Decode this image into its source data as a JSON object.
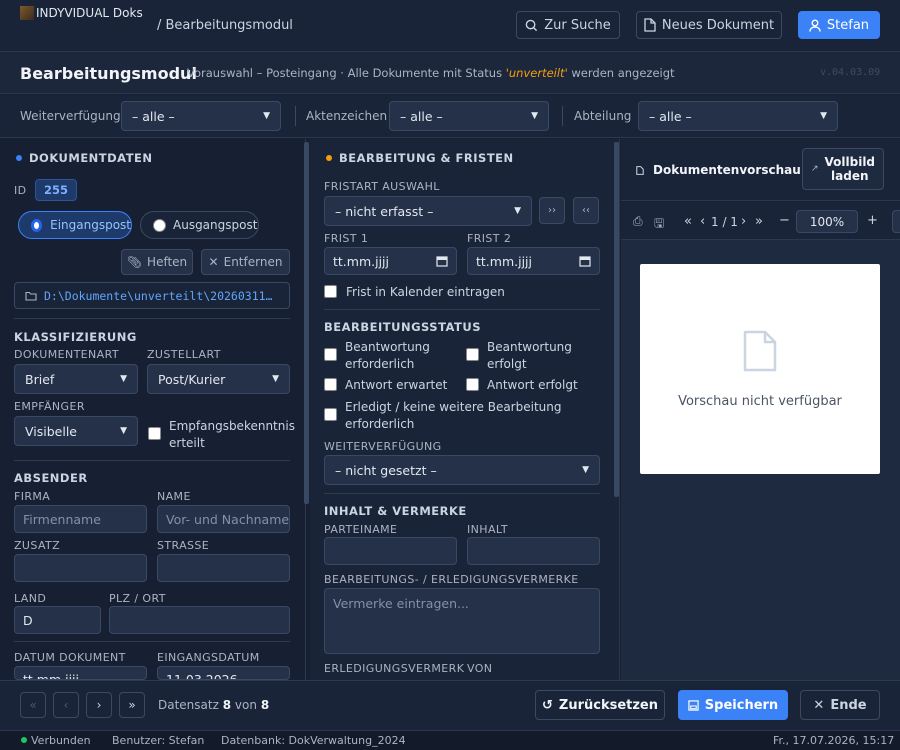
{
  "app": {
    "logo_text": "INDYVIDUAL Doks",
    "breadcrumb": "/ Bearbeitungsmodul",
    "search_label": "Zur Suche",
    "new_doc_label": "Neues Dokument",
    "user_label": "Stefan"
  },
  "module": {
    "title": "Bearbeitungsmodul",
    "subtitle_pre": "Vorauswahl – Posteingang · Alle Dokumente mit Status ",
    "subtitle_status": "'unverteilt'",
    "subtitle_post": " werden angezeigt",
    "version": "v.04.03.09"
  },
  "filters": {
    "weiterverfuegung_label": "Weiterverfügung",
    "weiterverfuegung_value": "– alle –",
    "aktenzeichen_label": "Aktenzeichen",
    "aktenzeichen_value": "– alle –",
    "abteilung_label": "Abteilung",
    "abteilung_value": "– alle –"
  },
  "left": {
    "head": "DOKUMENTDATEN",
    "id_label": "ID",
    "id_value": "255",
    "radio_in": "Eingangspost",
    "radio_out": "Ausgangspost",
    "heften": "Heften",
    "entfernen": "Entfernen",
    "path": "D:\\Dokumente\\unverteilt\\20260311…",
    "klass_head": "KLASSIFIZIERUNG",
    "dokart_label": "DOKUMENTENART",
    "dokart_value": "Brief",
    "zustell_label": "ZUSTELLART",
    "zustell_value": "Post/Kurier",
    "empf_label": "EMPFÄNGER",
    "empf_value": "Visibelle",
    "empfbek_label": "Empfangsbekenntnis erteilt",
    "abs_head": "ABSENDER",
    "firma_label": "FIRMA",
    "firma_ph": "Firmenname",
    "name_label": "NAME",
    "name_ph": "Vor- und Nachname",
    "zusatz_label": "ZUSATZ",
    "strasse_label": "STRASSE",
    "land_label": "LAND",
    "land_value": "D",
    "plz_label": "PLZ / ORT",
    "datum_dok_label": "DATUM DOKUMENT",
    "datum_dok_value": "tt.mm.jjjj",
    "eingang_label": "EINGANGSDATUM",
    "eingang_value": "11.03.2026"
  },
  "mid": {
    "head": "BEARBEITUNG & FRISTEN",
    "fristart_label": "FRISTART AUSWAHL",
    "fristart_value": "– nicht erfasst –",
    "frist1_label": "FRIST 1",
    "frist2_label": "FRIST 2",
    "date_ph": "tt.mm.jjjj",
    "kalender_label": "Frist in Kalender eintragen",
    "status_head": "BEARBEITUNGSSTATUS",
    "chk_beantw_erf": "Beantwortung erforderlich",
    "chk_beantw_erfolgt": "Beantwortung erfolgt",
    "chk_antw_erw": "Antwort erwartet",
    "chk_antw_erfolgt": "Antwort erfolgt",
    "chk_erledigt": "Erledigt / keine weitere Bearbeitung erforderlich",
    "weiter_label": "WEITERVERFÜGUNG",
    "weiter_value": "– nicht gesetzt –",
    "inhalt_head": "INHALT & VERMERKE",
    "partei_label": "PARTEINAME",
    "inhalt_label": "INHALT",
    "vermerke_label": "BEARBEITUNGS- / ERLEDIGUNGSVERMERKE",
    "vermerke_ph": "Vermerke eintragen...",
    "erledig_label": "ERLEDIGUNGSVERMERK",
    "von_label": "VON"
  },
  "preview": {
    "head": "Dokumentenvorschau",
    "full_btn_line1": "Vollbild",
    "full_btn_line2": "laden",
    "page_info": "1 / 1",
    "zoom": "100%",
    "empty_text": "Vorschau nicht verfügbar"
  },
  "bottom": {
    "record_pre": "Datensatz",
    "record_current": "8",
    "record_mid": "von",
    "record_total": "8",
    "reset_label": "Zurücksetzen",
    "save_label": "Speichern",
    "end_label": "Ende"
  },
  "status": {
    "connected": "Verbunden",
    "user": "Benutzer: Stefan",
    "db": "Datenbank: DokVerwaltung_2024",
    "datetime": "Fr., 17.07.2026, 15:17"
  },
  "colors": {
    "accent": "#3b82f6",
    "warning": "#f59e0b",
    "ok": "#22c55e"
  }
}
